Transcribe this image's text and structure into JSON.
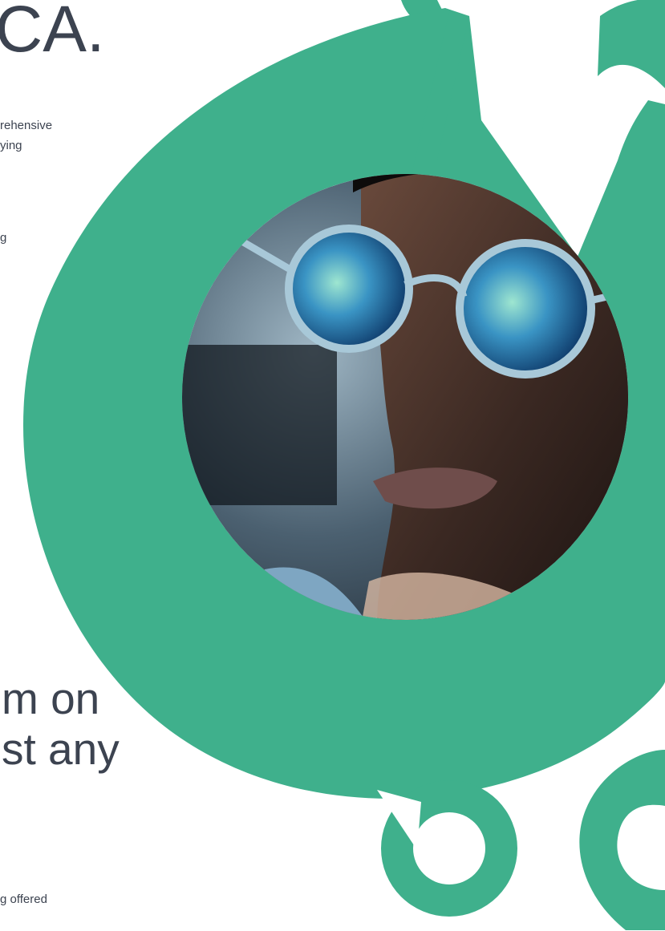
{
  "hero": {
    "title_visible": "CA."
  },
  "intro": {
    "line_1": "rehensive",
    "line_2": "ying"
  },
  "second_paragraph": {
    "line_1": "g"
  },
  "headline": {
    "line_1": "m on",
    "line_2": "st any"
  },
  "footer_text": {
    "line_1": "g offered"
  },
  "colors": {
    "brand_green": "#3fb08c",
    "text": "#3c4350",
    "background": "#ffffff"
  },
  "decorations": {
    "main_ring": "green-ring-shape",
    "photo": "person-with-glasses-photo",
    "small_rings": [
      "green-ring-icon",
      "green-ring-icon",
      "green-ring-icon"
    ]
  }
}
